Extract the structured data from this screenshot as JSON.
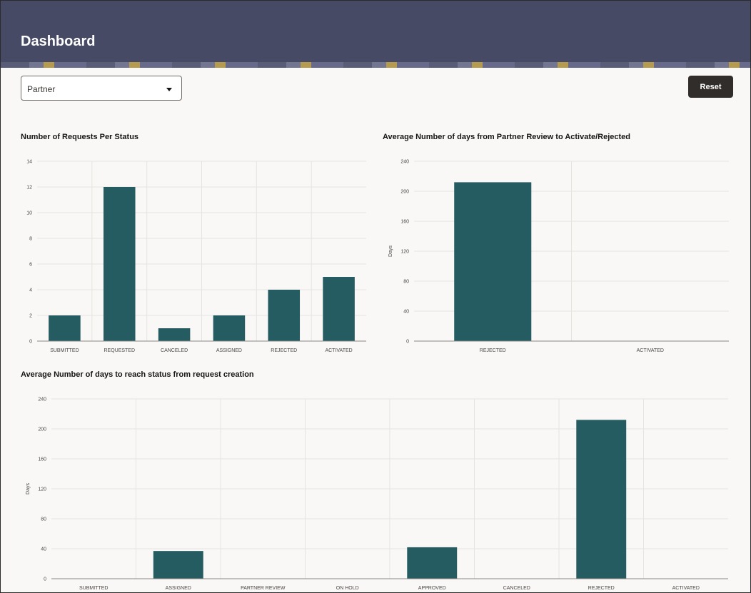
{
  "header": {
    "title": "Dashboard"
  },
  "filter": {
    "selected": "Partner"
  },
  "toolbar": {
    "reset_label": "Reset"
  },
  "colors": {
    "bar": "#255c62",
    "header": "#464a65",
    "grid": "#e6e4e1"
  },
  "chart_data": [
    {
      "type": "bar",
      "title": "Number of Requests Per Status",
      "categories": [
        "SUBMITTED",
        "REQUESTED",
        "CANCELED",
        "ASSIGNED",
        "REJECTED",
        "ACTIVATED"
      ],
      "values": [
        2,
        12,
        1,
        2,
        4,
        5
      ],
      "yticks": [
        "0",
        "2",
        "4",
        "6",
        "8",
        "10",
        "12",
        "14"
      ],
      "ylim": [
        0,
        14
      ],
      "xlabel": "",
      "ylabel": "",
      "grid": true
    },
    {
      "type": "bar",
      "title": "Average Number of days from Partner Review to Activate/Rejected",
      "categories": [
        "REJECTED",
        "ACTIVATED"
      ],
      "values": [
        212,
        0
      ],
      "yticks": [
        "0",
        "40",
        "80",
        "120",
        "160",
        "200",
        "240"
      ],
      "ylim": [
        0,
        240
      ],
      "xlabel": "",
      "ylabel": "Days",
      "grid": true
    },
    {
      "type": "bar",
      "title": "Average Number of days to reach status from request creation",
      "categories": [
        "SUBMITTED",
        "ASSIGNED",
        "PARTNER REVIEW",
        "ON HOLD",
        "APPROVED",
        "CANCELED",
        "REJECTED",
        "ACTIVATED"
      ],
      "values": [
        0,
        37,
        0,
        0,
        42,
        0,
        212,
        0
      ],
      "yticks": [
        "0",
        "40",
        "80",
        "120",
        "160",
        "200",
        "240"
      ],
      "ylim": [
        0,
        240
      ],
      "xlabel": "",
      "ylabel": "Days",
      "grid": true
    }
  ]
}
